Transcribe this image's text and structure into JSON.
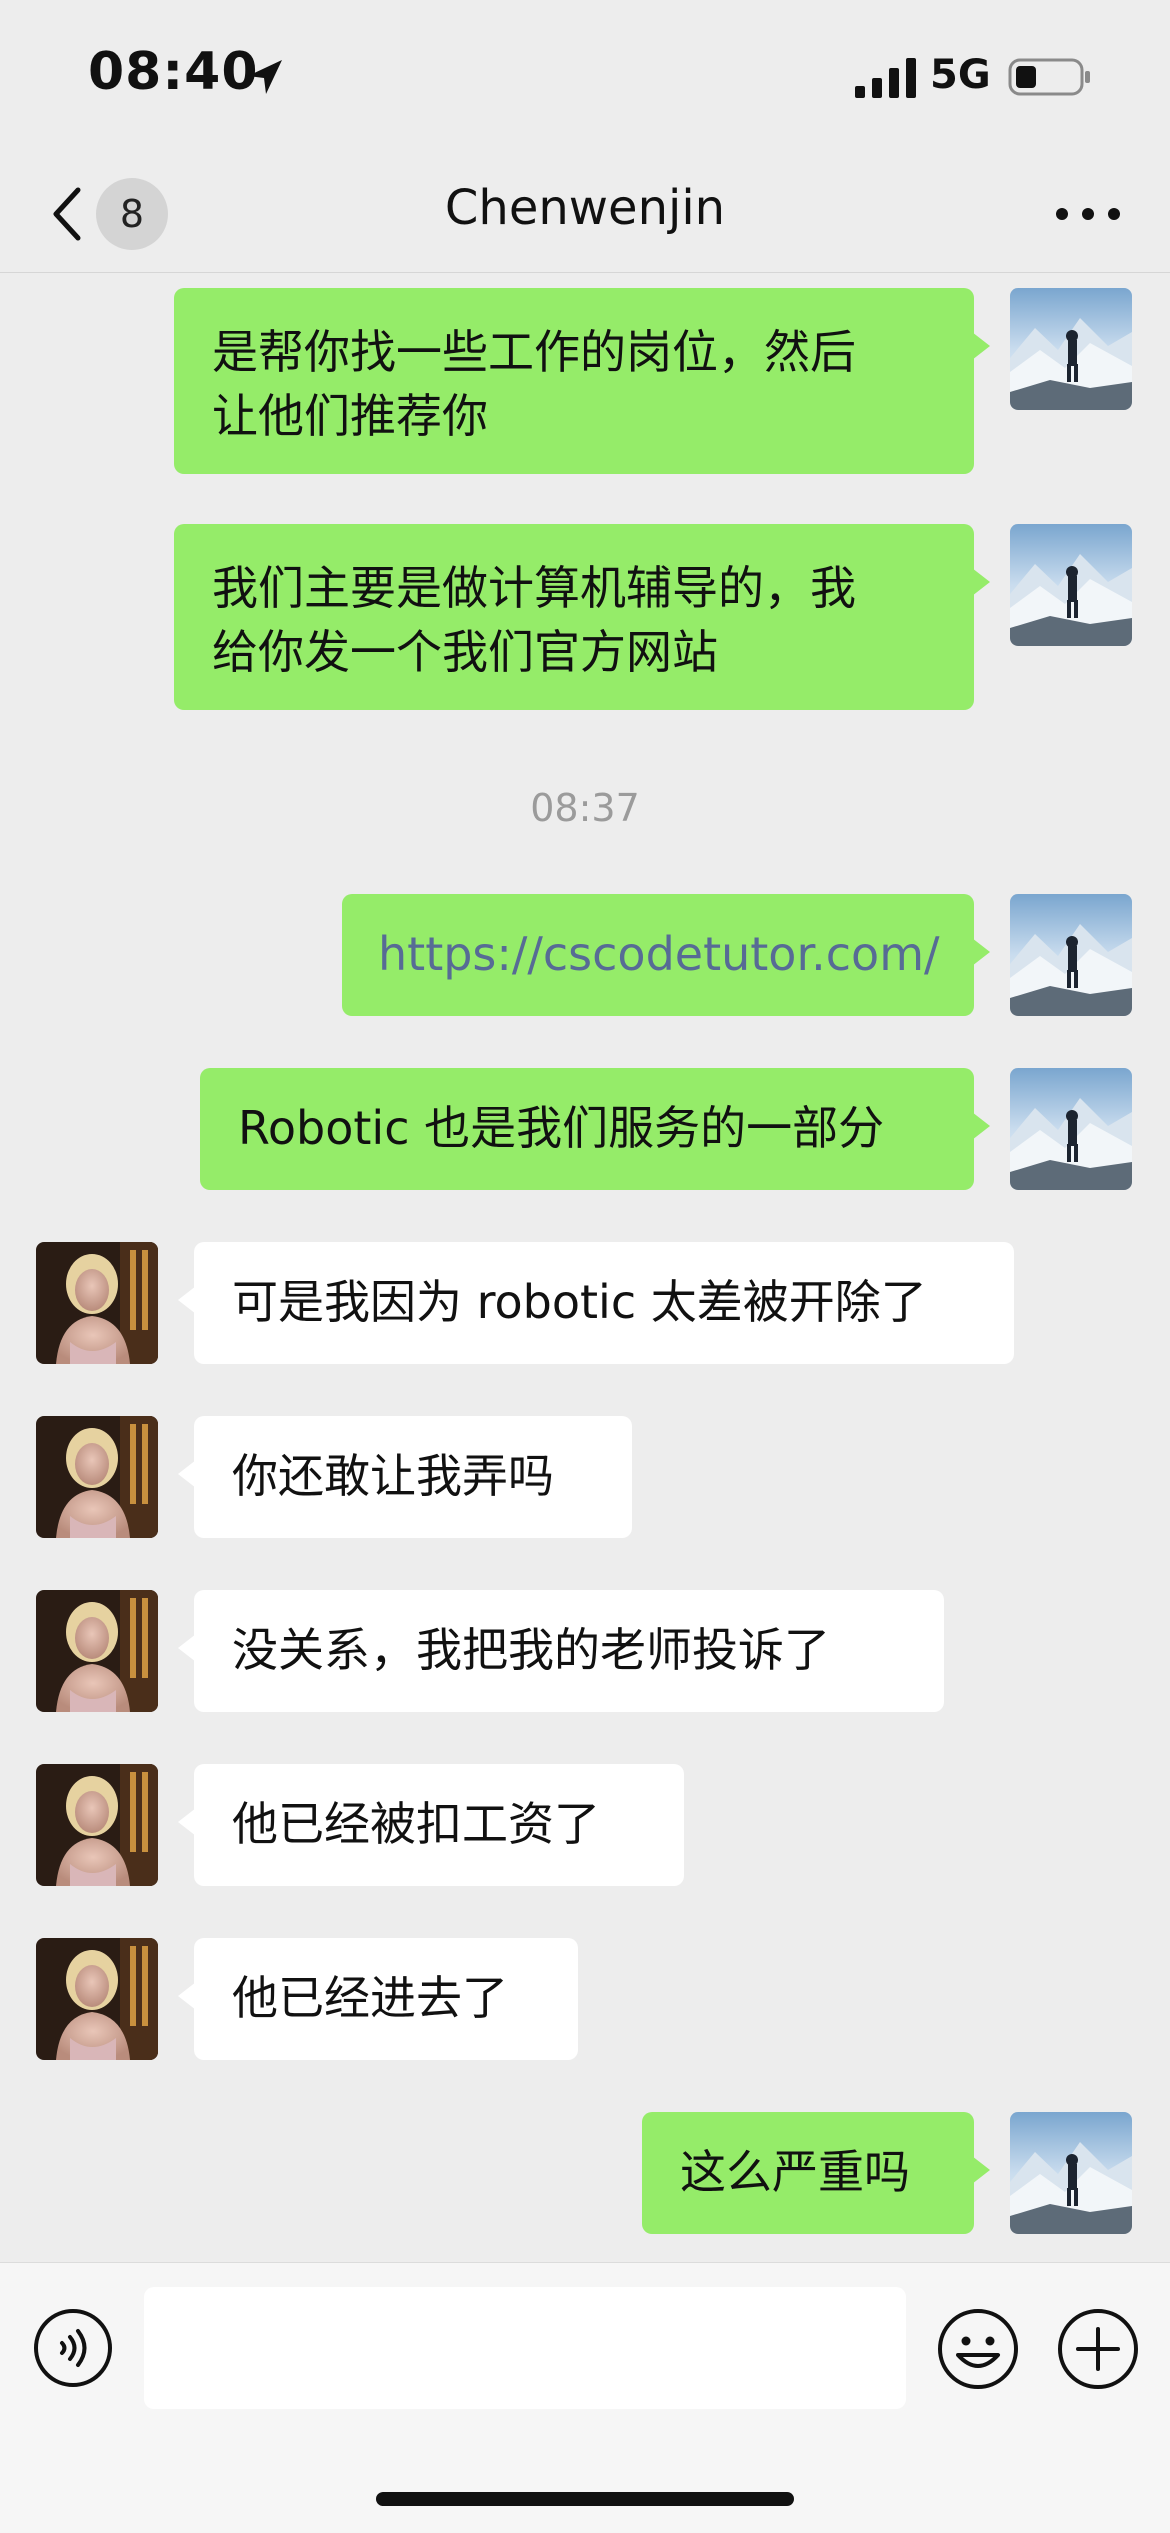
{
  "status_bar": {
    "time": "08:40",
    "network": "5G",
    "icons": [
      "location-arrow-icon",
      "signal-icon",
      "battery-icon"
    ]
  },
  "nav": {
    "unread_count": "8",
    "title": "Chenwenjin",
    "icons": [
      "chevron-left-icon",
      "more-icon"
    ]
  },
  "messages": [
    {
      "sender": "me",
      "lines": [
        "是帮你找一些工作的岗位，然后",
        "让他们推荐你"
      ]
    },
    {
      "sender": "me",
      "lines": [
        "我们主要是做计算机辅导的，我",
        "给你发一个我们官方网站"
      ]
    },
    {
      "sender": "system",
      "text": "08:37"
    },
    {
      "sender": "me",
      "text": "https://cscodetutor.com/",
      "is_link": true
    },
    {
      "sender": "me",
      "text": "Robotic 也是我们服务的一部分"
    },
    {
      "sender": "them",
      "text": "可是我因为 robotic 太差被开除了"
    },
    {
      "sender": "them",
      "text": "你还敢让我弄吗"
    },
    {
      "sender": "them",
      "text": "没关系，我把我的老师投诉了"
    },
    {
      "sender": "them",
      "text": "他已经被扣工资了"
    },
    {
      "sender": "them",
      "text": "他已经进去了"
    },
    {
      "sender": "me",
      "text": "这么严重吗"
    }
  ],
  "input": {
    "value": "",
    "placeholder": "",
    "icons": [
      "voice-icon",
      "emoji-icon",
      "plus-icon"
    ]
  },
  "colors": {
    "background": "#ededed",
    "my_bubble": "#95ec69",
    "their_bubble": "#ffffff",
    "link": "#576b95",
    "timestamp": "#9b9b9b"
  }
}
